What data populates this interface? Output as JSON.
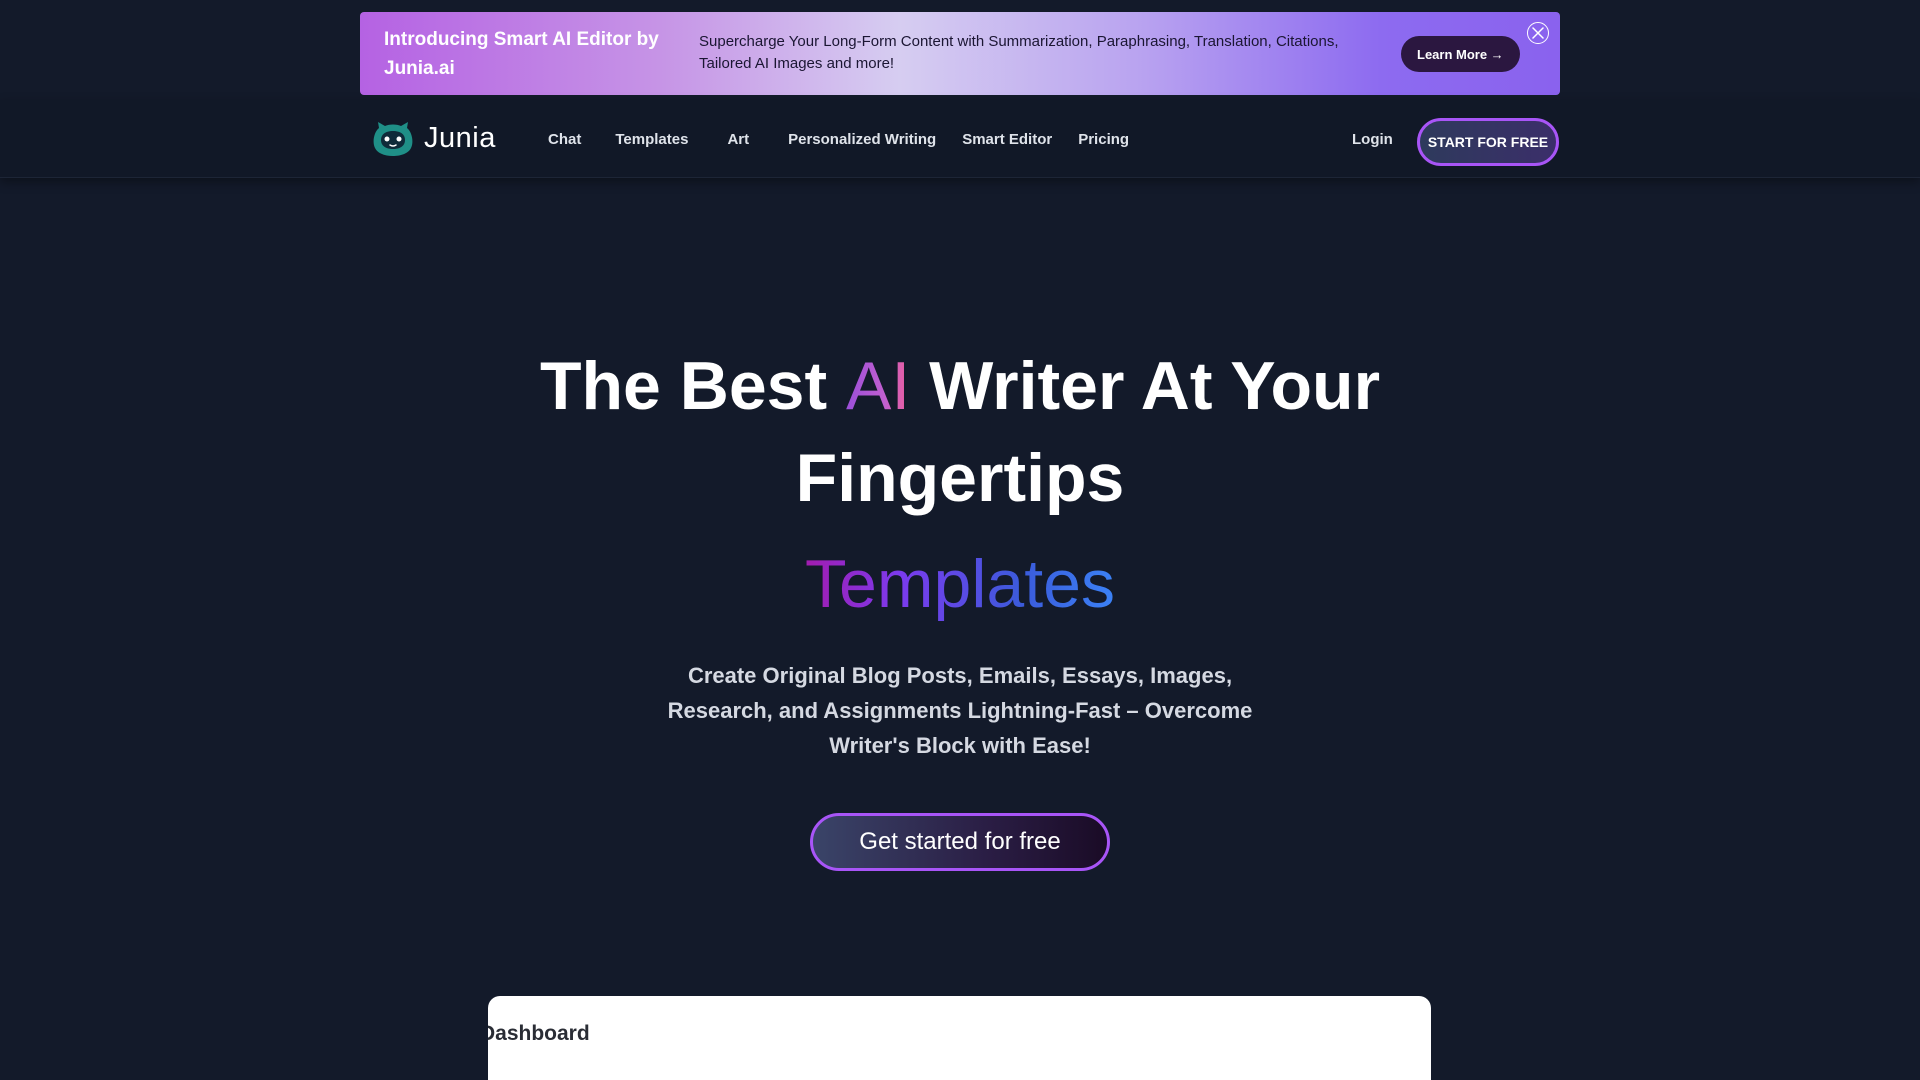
{
  "banner": {
    "title": "Introducing Smart AI Editor by Junia.ai",
    "description": "Supercharge Your Long-Form Content with Summarization, Paraphrasing, Translation, Citations, Tailored AI Images and more!",
    "learn_more_label": "Learn More →",
    "close_icon": "close-icon"
  },
  "nav": {
    "logo_text": "Junia",
    "logo_icon": "cat-face-icon",
    "links": [
      "Chat",
      "Templates",
      "Art",
      "Personalized Writing",
      "Smart Editor",
      "Pricing"
    ],
    "login_label": "Login",
    "start_label": "START FOR FREE"
  },
  "hero": {
    "title_part1": "The Best ",
    "title_ai": "AI",
    "title_part2": " Writer At Your Fingertips",
    "rotating_word": "Templates",
    "subtitle": "Create Original Blog Posts, Emails, Essays, Images, Research, and Assignments Lightning-Fast – Overcome Writer's Block with Ease!",
    "cta_label": "Get started for free"
  },
  "preview": {
    "heading": "Dashboard"
  },
  "colors": {
    "background": "#131a2a",
    "nav_background": "#111827",
    "accent_purple": "#a855f7",
    "accent_blue": "#3b82f6"
  }
}
